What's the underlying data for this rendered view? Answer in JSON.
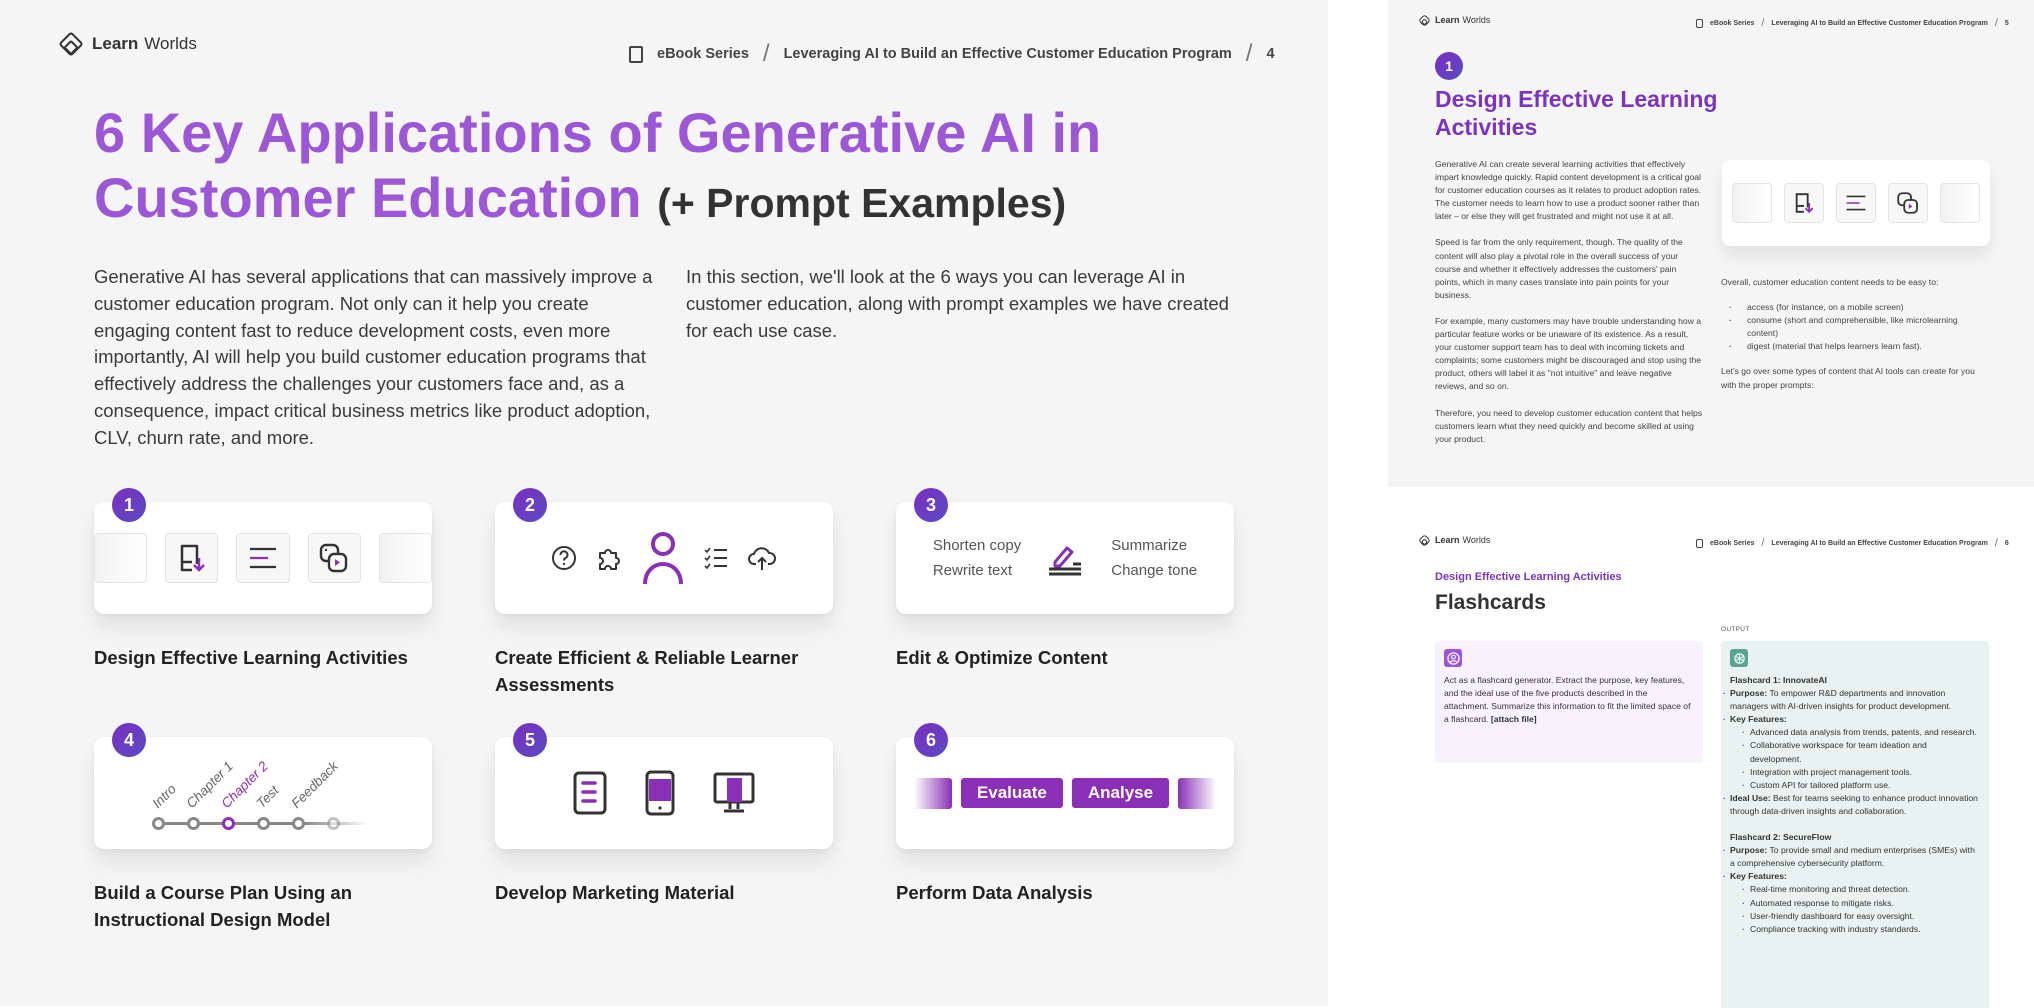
{
  "brand": {
    "logo_bold": "Learn",
    "logo_light": "Worlds",
    "accent": "#9b57d6",
    "accent_dark": "#8a2fb8"
  },
  "breadcrumb": {
    "series": "eBook Series",
    "title": "Leveraging AI to Build an Effective Customer Education Program",
    "icon": "ebook-download-icon"
  },
  "page4": {
    "page_number": "4",
    "title_main": "6 Key Applications of Generative AI in Customer Education",
    "title_sub": "(+ Prompt Examples)",
    "intro_left": "Generative AI has several applications that can massively improve a customer education program. Not only can it help you create engaging content fast to reduce development costs, even more importantly, AI will help you build customer education programs that effectively address the challenges your customers face and, as a consequence, impact critical business metrics like product adoption, CLV, churn rate, and more.",
    "intro_right": "In this section, we'll look at the 6 ways you can leverage AI in customer education, along with prompt examples we have created for each use case.",
    "tiles": [
      {
        "number": "1",
        "label": "Design Effective Learning Activities",
        "icons": [
          "ebook-download-icon",
          "text-align-icon",
          "media-gallery-icon"
        ]
      },
      {
        "number": "2",
        "label": "Create Efficient & Reliable Learner Assessments",
        "icons": [
          "question-circle-icon",
          "puzzle-icon",
          "learner-icon",
          "checklist-icon",
          "cloud-upload-icon"
        ]
      },
      {
        "number": "3",
        "label": "Edit & Optimize Content",
        "options_left": [
          "Shorten copy",
          "Rewrite text"
        ],
        "options_right": [
          "Summarize",
          "Change tone"
        ],
        "icon": "pencil-edit-icon"
      },
      {
        "number": "4",
        "label": "Build a Course Plan Using an Instructional Design Model",
        "steps": [
          "Intro",
          "Chapter 1",
          "Chapter 2",
          "Test",
          "Feedback"
        ],
        "active_step": "Chapter 2"
      },
      {
        "number": "5",
        "label": "Develop Marketing Material",
        "icons": [
          "tablet-icon",
          "phone-icon",
          "desktop-icon"
        ]
      },
      {
        "number": "6",
        "label": "Perform Data Analysis",
        "buttons": [
          "Evaluate",
          "Analyse"
        ]
      }
    ]
  },
  "page5": {
    "page_number": "5",
    "badge": "1",
    "title": "Design Effective Learning Activities",
    "paragraphs": [
      "Generative AI can create several learning activities that effectively impart knowledge quickly. Rapid content development is a critical goal for customer education courses as it relates to product adoption rates. The customer needs to learn how to use a product sooner rather than later – or else they will get frustrated and might not use it at all.",
      "Speed is far from the only requirement, though. The quality of the content will also play a pivotal role in the overall success of your course and whether it effectively addresses the customers' pain points, which in many cases translate into pain points for your business.",
      "For example, many customers may have trouble understanding how a particular feature works or be unaware of its existence. As a result, your customer support team has to deal with incoming tickets and complaints; some customers might be discouraged and stop using the product, others will label it as \"not intuitive\" and leave negative reviews, and so on.",
      "Therefore, you need to develop customer education content that helps customers learn what they need quickly and become skilled at using your product."
    ],
    "right_intro": "Overall, customer education content needs to be easy to:",
    "bullets": [
      "access (for instance, on a mobile screen)",
      "consume (short and comprehensible, like microlearning content)",
      "digest (material that helps learners learn fast)."
    ],
    "right_outro": "Let's go over some types of content that AI tools can create for you with the proper prompts:"
  },
  "page6": {
    "page_number": "6",
    "kicker": "Design Effective Learning Activities",
    "title": "Flashcards",
    "output_label": "OUTPUT",
    "prompt_text": "Act as a flashcard generator. Extract the purpose, key features, and the ideal use of the five products described in the attachment. Summarize this information to fit the limited space of a flashcard.",
    "prompt_attach": "[attach file]",
    "flashcards": [
      {
        "heading": "Flashcard 1: InnovateAI",
        "purpose_label": "Purpose:",
        "purpose": "To empower R&D departments and innovation managers with AI-driven insights for product development.",
        "features_label": "Key Features:",
        "features": [
          "Advanced data analysis from trends, patents, and research.",
          "Collaborative workspace for team ideation and development.",
          "Integration with project management tools.",
          "Custom API for tailored platform use."
        ],
        "ideal_label": "Ideal Use:",
        "ideal": "Best for teams seeking to enhance product innovation through data-driven insights and collaboration."
      },
      {
        "heading": "Flashcard 2: SecureFlow",
        "purpose_label": "Purpose:",
        "purpose": "To provide small and medium enterprises (SMEs) with a comprehensive cybersecurity platform.",
        "features_label": "Key Features:",
        "features": [
          "Real-time monitoring and threat detection.",
          "Automated response to mitigate risks.",
          "User-friendly dashboard for easy oversight.",
          "Compliance tracking with industry standards."
        ]
      }
    ]
  }
}
